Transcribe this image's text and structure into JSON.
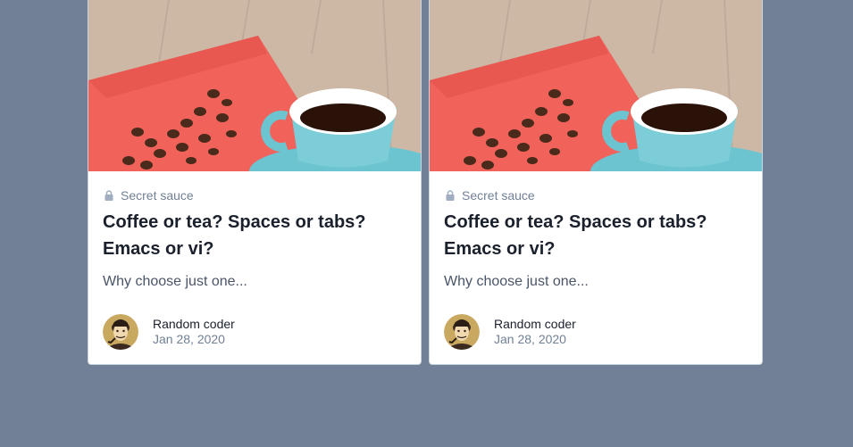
{
  "cards": [
    {
      "category": "Secret sauce",
      "title": "Coffee or tea? Spaces or tabs? Emacs or vi?",
      "excerpt": "Why choose just one...",
      "author": "Random coder",
      "date": "Jan 28, 2020"
    },
    {
      "category": "Secret sauce",
      "title": "Coffee or tea? Spaces or tabs? Emacs or vi?",
      "excerpt": "Why choose just one...",
      "author": "Random coder",
      "date": "Jan 28, 2020"
    }
  ],
  "icons": {
    "category": "lock-icon",
    "image": "coffee-cup-photo",
    "avatar": "man-with-pipe-avatar"
  },
  "colors": {
    "background": "#718096",
    "card": "#ffffff",
    "title": "#1a202c",
    "muted": "#718096"
  }
}
